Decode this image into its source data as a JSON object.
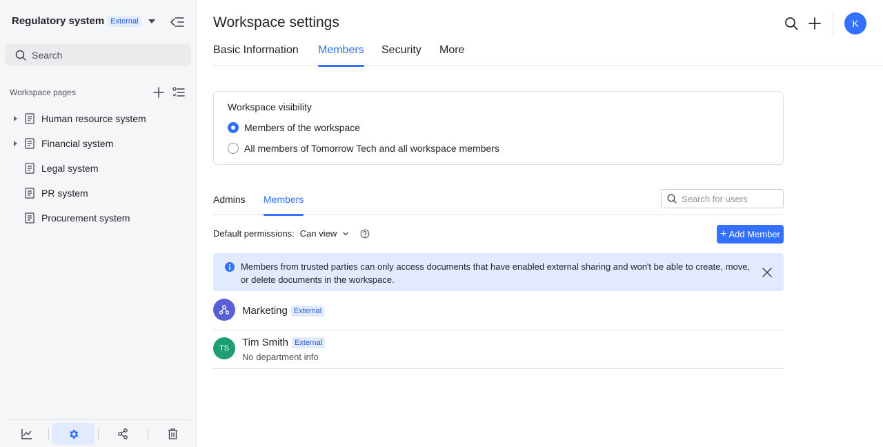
{
  "sidebar": {
    "workspace_name": "Regulatory system",
    "workspace_badge": "External",
    "search_label": "Search",
    "pages_label": "Workspace pages",
    "pages": [
      {
        "label": "Human resource system",
        "expandable": true
      },
      {
        "label": "Financial system",
        "expandable": true
      },
      {
        "label": "Legal system",
        "expandable": false
      },
      {
        "label": "PR system",
        "expandable": false
      },
      {
        "label": "Procurement system",
        "expandable": false
      }
    ],
    "footer_icons": [
      "chart-icon",
      "gear-icon",
      "share-icon",
      "trash-icon"
    ],
    "active_footer": "gear-icon"
  },
  "header": {
    "title": "Workspace settings",
    "avatar_initial": "K"
  },
  "tabs": [
    {
      "label": "Basic Information",
      "active": false
    },
    {
      "label": "Members",
      "active": true
    },
    {
      "label": "Security",
      "active": false
    },
    {
      "label": "More",
      "active": false
    }
  ],
  "visibility": {
    "title": "Workspace visibility",
    "options": [
      {
        "label": "Members of the workspace",
        "checked": true
      },
      {
        "label": "All members of Tomorrow Tech and all workspace members",
        "checked": false
      }
    ]
  },
  "member_tabs": [
    {
      "label": "Admins",
      "active": false
    },
    {
      "label": "Members",
      "active": true
    }
  ],
  "user_search": {
    "placeholder": "Search for users"
  },
  "permissions": {
    "label": "Default permissions:",
    "value": "Can view"
  },
  "add_member_label": "Add Member",
  "info_banner": {
    "text": "Members from trusted parties can only access documents that have enabled external sharing and won't be able to create, move, or delete documents in the workspace."
  },
  "members": [
    {
      "name": "Marketing",
      "badge": "External",
      "sub": "",
      "avatar_type": "group-icon",
      "avatar_color": "#5b5fd6"
    },
    {
      "name": "Tim Smith",
      "badge": "External",
      "sub": "No department info",
      "initials": "TS",
      "avatar_color": "#1f9e76"
    }
  ],
  "colors": {
    "accent": "#3370ff",
    "badge_bg": "#e1eaff"
  }
}
